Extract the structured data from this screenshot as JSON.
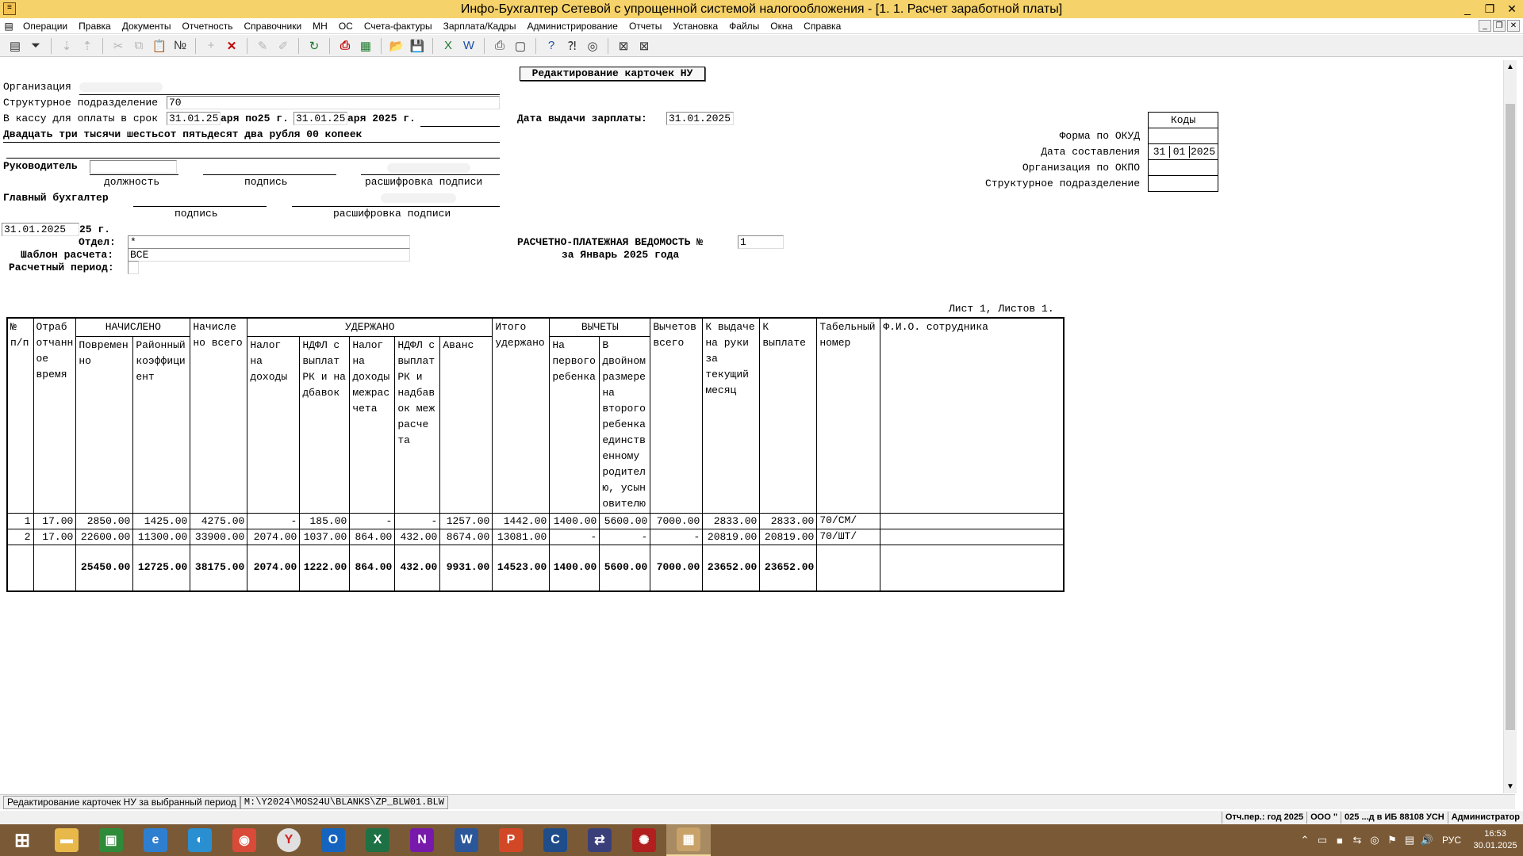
{
  "window": {
    "title": "Инфо-Бухгалтер Сетевой с упрощенной системой налогообложения - [1. 1. Расчет заработной платы]",
    "app_icon": "ledger-icon",
    "controls": [
      "_",
      "❐",
      "✕"
    ]
  },
  "menu": {
    "items": [
      "Операции",
      "Правка",
      "Документы",
      "Отчетность",
      "Справочники",
      "МН",
      "ОС",
      "Счета-фактуры",
      "Зарплата/Кадры",
      "Администрирование",
      "Отчеты",
      "Установка",
      "Файлы",
      "Окна",
      "Справка"
    ],
    "mdi_controls": [
      "_",
      "❐",
      "✕"
    ]
  },
  "toolbar": {
    "buttons": [
      {
        "name": "form-view-icon",
        "glyph": "▤",
        "state": "normal"
      },
      {
        "name": "filter-icon",
        "glyph": "⏷",
        "state": "normal"
      },
      {
        "name": "sort-asc-icon",
        "glyph": "⇣",
        "state": "disabled"
      },
      {
        "name": "sort-desc-icon",
        "glyph": "⇡",
        "state": "disabled"
      },
      {
        "name": "cut-icon",
        "glyph": "✂",
        "state": "disabled"
      },
      {
        "name": "copy-icon",
        "glyph": "⧉",
        "state": "disabled"
      },
      {
        "name": "paste-icon",
        "glyph": "📋",
        "state": "disabled"
      },
      {
        "name": "number-icon",
        "glyph": "№",
        "state": "normal"
      },
      {
        "name": "add-icon",
        "glyph": "+",
        "state": "disabled"
      },
      {
        "name": "delete-icon",
        "glyph": "✕",
        "state": "red"
      },
      {
        "name": "edit-icon",
        "glyph": "✎",
        "state": "disabled"
      },
      {
        "name": "edit-all-icon",
        "glyph": "✐",
        "state": "disabled"
      },
      {
        "name": "refresh-icon",
        "glyph": "↻",
        "state": "green"
      },
      {
        "name": "pdf-icon",
        "glyph": "⎙",
        "state": "red"
      },
      {
        "name": "calculator-icon",
        "glyph": "▦",
        "state": "green"
      },
      {
        "name": "open-folder-icon",
        "glyph": "📂",
        "state": "normal"
      },
      {
        "name": "save-icon",
        "glyph": "💾",
        "state": "blue"
      },
      {
        "name": "excel-icon",
        "glyph": "X",
        "state": "green"
      },
      {
        "name": "word-icon",
        "glyph": "W",
        "state": "blue"
      },
      {
        "name": "print-icon",
        "glyph": "⎙",
        "state": "normal"
      },
      {
        "name": "preview-icon",
        "glyph": "▢",
        "state": "normal"
      },
      {
        "name": "help-icon",
        "glyph": "?",
        "state": "blue"
      },
      {
        "name": "context-help-icon",
        "glyph": "⁈",
        "state": "normal"
      },
      {
        "name": "compass-icon",
        "glyph": "◎",
        "state": "normal"
      },
      {
        "name": "close-doc-icon",
        "glyph": "⊠",
        "state": "normal"
      },
      {
        "name": "close-all-icon",
        "glyph": "⊠",
        "state": "normal"
      }
    ]
  },
  "doc": {
    "header_button": "Редактирование карточек НУ",
    "org_label": "Организация",
    "subdivision_label": "Структурное подразделение",
    "subdivision_value": "70",
    "cash_label": "В кассу для оплаты в срок",
    "cash_from": "31.01.25",
    "cash_mid": "аря по25 г.",
    "cash_to": "31.01.25",
    "cash_end": "аря 2025 г.",
    "amount_words": "Двадцать три тысячи шестьсот пятьдесят два рубля 00 копеек",
    "head_label": "Руководитель",
    "sub_position": "должность",
    "sub_signature": "подпись",
    "sub_decoding": "расшифровка подписи",
    "chief_label": "Главный бухгалтер",
    "chief_signature": "подпись",
    "chief_decoding": "расшифровка подписи",
    "date_value": "31.01.2025",
    "date_suffix": "25 г.",
    "dept_label": "Отдел:",
    "dept_value": "*",
    "template_label": "Шаблон расчета:",
    "template_value": "ВСЕ",
    "period_label": "Расчетный период:",
    "period_value": "",
    "pay_date_label": "Дата выдачи зарплаты:",
    "pay_date_value": "31.01.2025",
    "sheet_label": "РАСЧЕТНО-ПЛАТЕЖНАЯ ВЕДОМОСТЬ №",
    "sheet_no": "1",
    "sheet_period": "за Январь 2025 года",
    "pages": "Лист 1, Листов 1.",
    "codes": {
      "header": "Коды",
      "okud_label": "Форма по ОКУД",
      "date_label": "Дата составления",
      "day": "31",
      "month": "01",
      "year": "2025",
      "okpo_label": "Организация по ОКПО",
      "sub_label": "Структурное подразделение"
    }
  },
  "table": {
    "h_no": [
      "№",
      "п/п"
    ],
    "h_worked": [
      "Отраб",
      "отчанн",
      "ое",
      "время"
    ],
    "h_accrued": "НАЧИСЛЕНО",
    "h_time": [
      "Повремен",
      "но"
    ],
    "h_regional": [
      "Районный",
      "коэффици",
      "ент"
    ],
    "h_accrued_total": [
      "Начисле",
      "но всего"
    ],
    "h_withheld": "УДЕРЖАНО",
    "h_tax": [
      "Налог",
      "на",
      "доходы"
    ],
    "h_ndfl": [
      "НДФЛ с",
      "выплат",
      "РК и на",
      "дбавок"
    ],
    "h_tax_inter": [
      "Налог",
      "на",
      "доходы",
      "межрас",
      "чета"
    ],
    "h_ndfl_inter": [
      "НДФЛ с",
      "выплат",
      "РК и",
      "надбав",
      "ок меж",
      "расче",
      "та"
    ],
    "h_advance": "Аванс",
    "h_withheld_total": [
      "Итого",
      "удержано"
    ],
    "h_deductions": "ВЫЧЕТЫ",
    "h_first_child": [
      "На",
      "первого",
      "ребенка"
    ],
    "h_double": [
      "В",
      "двойном",
      "размере",
      "на",
      "второго",
      "ребенка",
      "единств",
      "енному",
      "родител",
      "ю, усын",
      "овителю"
    ],
    "h_deduct_total": [
      "Вычетов",
      "всего"
    ],
    "h_to_hand": [
      "К выдаче",
      "на руки",
      "за",
      "текущий",
      "месяц"
    ],
    "h_to_pay": [
      "К",
      "выплате"
    ],
    "h_tab": [
      "Табельный",
      "номер"
    ],
    "h_fio": "Ф.И.О. сотрудника",
    "rows": [
      {
        "no": "1",
        "worked": "17.00",
        "time": "2850.00",
        "regional": "1425.00",
        "accrued": "4275.00",
        "tax": "-",
        "ndfl": "185.00",
        "tax_inter": "-",
        "ndfl_inter": "-",
        "advance": "1257.00",
        "withheld": "1442.00",
        "first_child": "1400.00",
        "double": "5600.00",
        "deduct": "7000.00",
        "to_hand": "2833.00",
        "to_pay": "2833.00",
        "tab": "70/СМ/",
        "fio": ""
      },
      {
        "no": "2",
        "worked": "17.00",
        "time": "22600.00",
        "regional": "11300.00",
        "accrued": "33900.00",
        "tax": "2074.00",
        "ndfl": "1037.00",
        "tax_inter": "864.00",
        "ndfl_inter": "432.00",
        "advance": "8674.00",
        "withheld": "13081.00",
        "first_child": "-",
        "double": "-",
        "deduct": "-",
        "to_hand": "20819.00",
        "to_pay": "20819.00",
        "tab": "70/ШТ/",
        "fio": ""
      }
    ],
    "total": {
      "no": "",
      "worked": "",
      "time": "25450.00",
      "regional": "12725.00",
      "accrued": "38175.00",
      "tax": "2074.00",
      "ndfl": "1222.00",
      "tax_inter": "864.00",
      "ndfl_inter": "432.00",
      "advance": "9931.00",
      "withheld": "14523.00",
      "first_child": "1400.00",
      "double": "5600.00",
      "deduct": "7000.00",
      "to_hand": "23652.00",
      "to_pay": "23652.00",
      "tab": "",
      "fio": ""
    }
  },
  "status": {
    "left": "Редактирование карточек НУ за выбранный период",
    "path": "M:\\Y2024\\MOS24U\\BLANKS\\ZP_BLW01.BLW"
  },
  "infobar": {
    "period": "Отч.пер.: год 2025",
    "org": "ООО \"",
    "db": "025 ...д в ИБ 88108 УСН",
    "user": "Администратор"
  },
  "taskbar": {
    "apps": [
      {
        "name": "windows-start-icon",
        "glyph": "⊞",
        "color": "#7a5a36",
        "active": false
      },
      {
        "name": "file-explorer-icon",
        "glyph": "▬",
        "color": "#e8b84a",
        "active": false
      },
      {
        "name": "store-icon",
        "glyph": "▣",
        "color": "#2e8b3a",
        "active": false
      },
      {
        "name": "internet-explorer-icon",
        "glyph": "e",
        "color": "#2f7fd1",
        "active": false
      },
      {
        "name": "edge-icon",
        "glyph": "◐",
        "color": "#2a8fd0",
        "active": false
      },
      {
        "name": "chrome-icon",
        "glyph": "◉",
        "color": "#d94a38",
        "active": false
      },
      {
        "name": "yandex-browser-icon",
        "glyph": "Y",
        "color": "#e0e0e0",
        "active": false
      },
      {
        "name": "outlook-icon",
        "glyph": "O",
        "color": "#1565c0",
        "active": false
      },
      {
        "name": "excel-app-icon",
        "glyph": "X",
        "color": "#1e7145",
        "active": false
      },
      {
        "name": "onenote-icon",
        "glyph": "N",
        "color": "#7719aa",
        "active": false
      },
      {
        "name": "word-app-icon",
        "glyph": "W",
        "color": "#2b579a",
        "active": false
      },
      {
        "name": "powerpoint-icon",
        "glyph": "P",
        "color": "#d24726",
        "active": false
      },
      {
        "name": "ccleaner-icon",
        "glyph": "C",
        "color": "#1f4d8a",
        "active": false
      },
      {
        "name": "vpn-icon",
        "glyph": "⇄",
        "color": "#3a3f7a",
        "active": false
      },
      {
        "name": "antivirus-icon",
        "glyph": "✺",
        "color": "#b21f1f",
        "active": false
      },
      {
        "name": "info-accountant-icon",
        "glyph": "▦",
        "color": "#c9a26a",
        "active": true
      }
    ],
    "tray": [
      "⌃",
      "▭",
      "■",
      "⇆",
      "◎",
      "⚑",
      "▤",
      "🔊"
    ],
    "lang": "РУС",
    "time": "16:53",
    "date": "30.01.2025"
  }
}
